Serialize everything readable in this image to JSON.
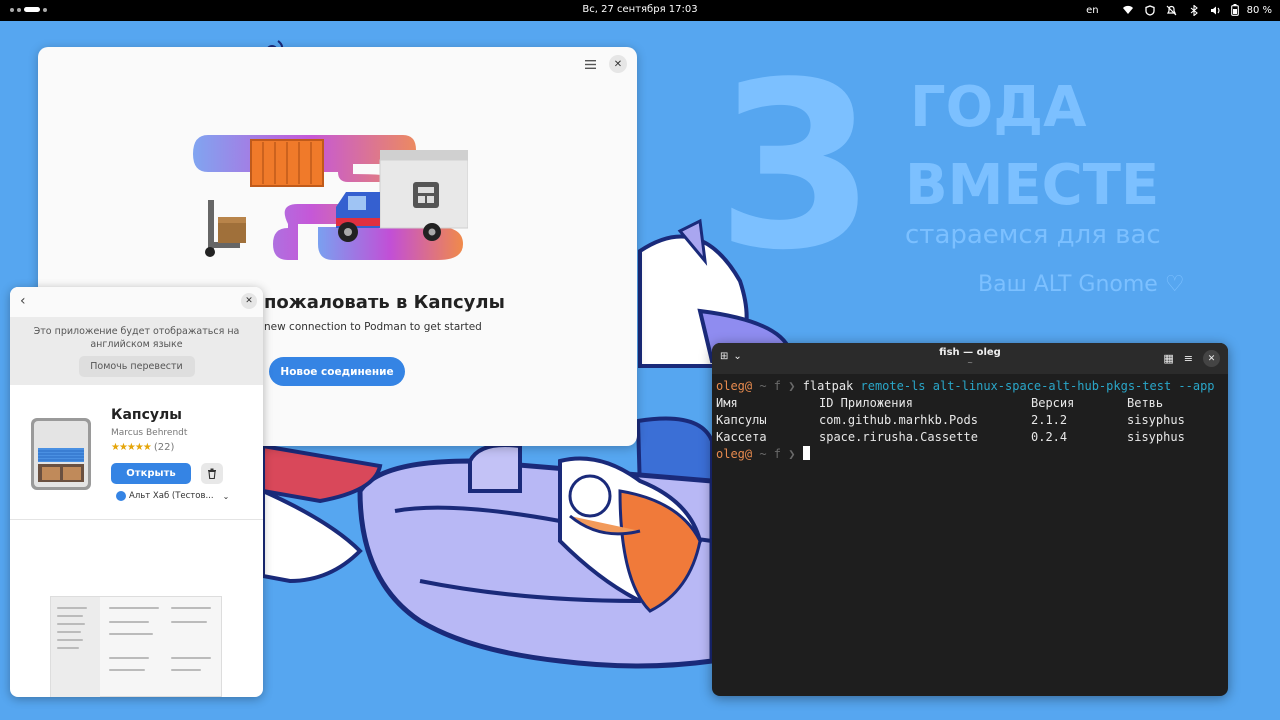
{
  "topbar": {
    "clock": "Вс, 27 сентября  17:03",
    "lang": "en",
    "battery": "80 %",
    "tray_icons": [
      "wifi-icon",
      "vpn-shield-icon",
      "notifications-off-icon",
      "bluetooth-icon",
      "volume-icon",
      "battery-icon"
    ]
  },
  "wallpaper": {
    "big_number": "3",
    "line1": "ГОДА",
    "line2": "ВМЕСТЕ",
    "line3": "стараемся для вас",
    "line4": "Ваш ALT Gnome ♡"
  },
  "pods": {
    "welcome_title": "пожаловать в Капсулы",
    "welcome_sub": "new connection to Podman to get started",
    "new_connection": "Новое соединение"
  },
  "software": {
    "banner_msg": "Это приложение будет отображаться на английском языке",
    "help_translate": "Помочь перевести",
    "app_name": "Капсулы",
    "developer": "Marcus Behrendt",
    "stars": "★★★★★",
    "rating_count": "(22)",
    "open": "Открыть",
    "source": "Альт Хаб (Тестов..."
  },
  "terminal": {
    "title": "fish — oleg",
    "subtitle": "~",
    "prompt_user": "oleg@",
    "prompt_host": " ~ f ❯ ",
    "command": "flatpak",
    "args": " remote-ls alt-linux-space-alt-hub-pkgs-test --app",
    "headers": [
      "Имя",
      "ID Приложения",
      "Версия",
      "Ветвь"
    ],
    "rows": [
      [
        "Капсулы",
        "com.github.marhkb.Pods",
        "2.1.2",
        "sisyphus"
      ],
      [
        "Кассета",
        "space.rirusha.Cassette",
        "0.2.4",
        "sisyphus"
      ]
    ]
  },
  "colors": {
    "wallpaper": "#56a6f0",
    "accent": "#3584e4",
    "prompt": "#e78a4e",
    "args": "#2aa6c8"
  }
}
